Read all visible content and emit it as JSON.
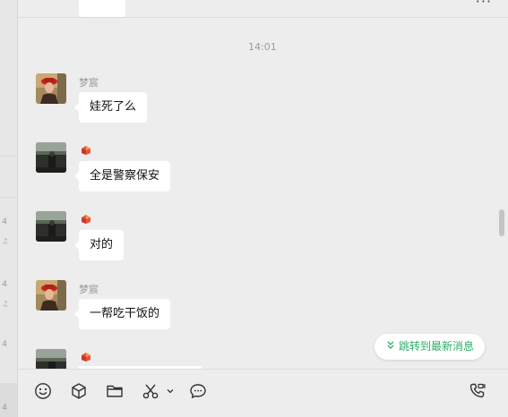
{
  "left_list": {
    "partial_digits": [
      "4",
      "4",
      "4",
      "4",
      "4"
    ]
  },
  "header": {
    "more_icon": "ellipsis-icon"
  },
  "chat": {
    "timestamp": "14:01",
    "messages": [
      {
        "sender": "梦宸",
        "text": "娃死了么",
        "avatar": "avatar-red-hat"
      },
      {
        "sender": "",
        "sender_icon": "sender-logo-icon",
        "text": "全是警察保安",
        "avatar": "avatar-dark-street"
      },
      {
        "sender": "",
        "sender_icon": "sender-logo-icon",
        "text": "对的",
        "avatar": "avatar-dark-street"
      },
      {
        "sender": "梦宸",
        "text": "一帮吃干饭的",
        "avatar": "avatar-red-hat"
      },
      {
        "sender": "",
        "sender_icon": "sender-logo-icon",
        "text": "",
        "avatar": "avatar-dark-street"
      }
    ],
    "jump_label": "跳转到最新消息"
  },
  "toolbar": {
    "icons": [
      "emoji-icon",
      "cube-icon",
      "folder-icon",
      "scissors-icon",
      "chevron-down-icon",
      "chat-bubble-icon",
      "phone-video-icon"
    ]
  },
  "colors": {
    "background": "#ededed",
    "bubble": "#ffffff",
    "accent_green": "#2aae67",
    "sender_gray": "#999999"
  }
}
